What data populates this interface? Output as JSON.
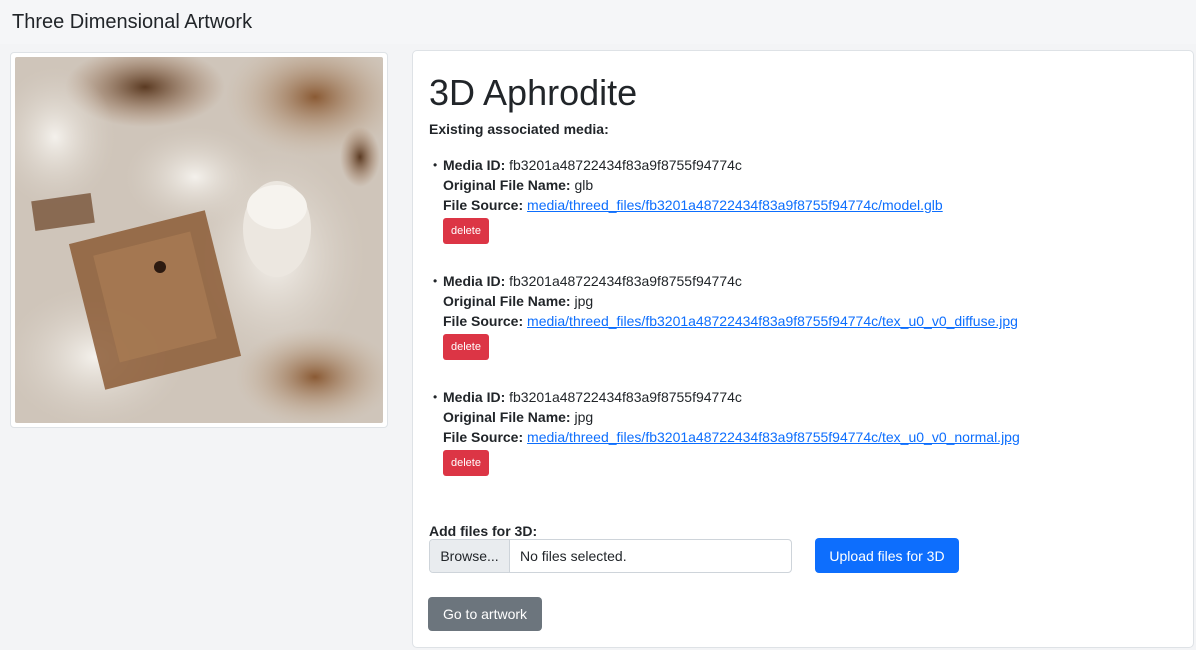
{
  "header": {
    "title": "Three Dimensional Artwork"
  },
  "artwork": {
    "title": "3D Aphrodite"
  },
  "media": {
    "heading": "Existing associated media:",
    "labels": {
      "media_id": "Media ID:",
      "original_file_name": "Original File Name:",
      "file_source": "File Source:"
    },
    "items": [
      {
        "media_id": "fb3201a48722434f83a9f8755f94774c",
        "original_file_name": "glb",
        "file_source": "media/threed_files/fb3201a48722434f83a9f8755f94774c/model.glb",
        "delete_label": "delete"
      },
      {
        "media_id": "fb3201a48722434f83a9f8755f94774c",
        "original_file_name": "jpg",
        "file_source": "media/threed_files/fb3201a48722434f83a9f8755f94774c/tex_u0_v0_diffuse.jpg",
        "delete_label": "delete"
      },
      {
        "media_id": "fb3201a48722434f83a9f8755f94774c",
        "original_file_name": "jpg",
        "file_source": "media/threed_files/fb3201a48722434f83a9f8755f94774c/tex_u0_v0_normal.jpg",
        "delete_label": "delete"
      }
    ]
  },
  "upload": {
    "label": "Add files for 3D:",
    "browse_label": "Browse...",
    "status": "No files selected.",
    "button_label": "Upload files for 3D"
  },
  "actions": {
    "go_to_artwork_label": "Go to artwork"
  },
  "colors": {
    "primary": "#0d6efd",
    "danger": "#dc3545",
    "secondary": "#6c757d",
    "link": "#0d6efd"
  }
}
